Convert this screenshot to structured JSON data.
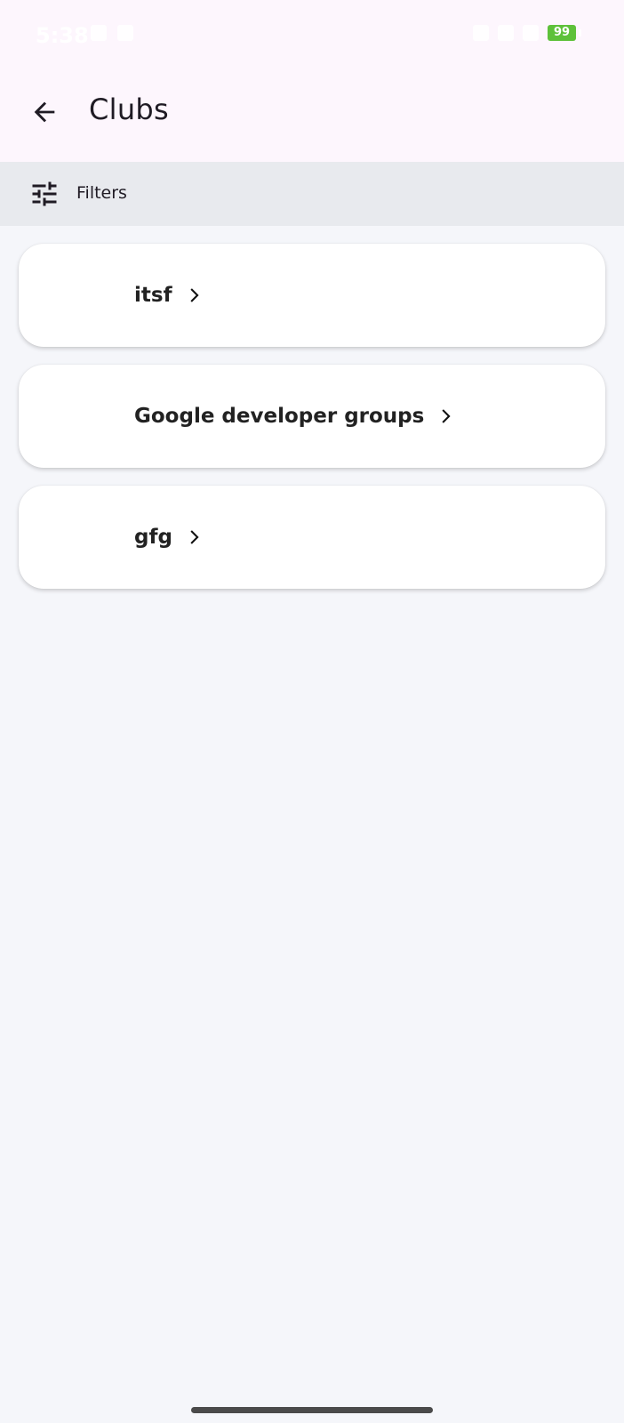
{
  "status_bar": {
    "time": "5:38",
    "battery": "99"
  },
  "app_bar": {
    "title": "Clubs",
    "back_icon": "arrow-back-icon"
  },
  "filter_bar": {
    "icon": "tune-icon",
    "label": "Filters"
  },
  "clubs": [
    {
      "name": "itsf"
    },
    {
      "name": "Google developer groups"
    },
    {
      "name": "gfg"
    }
  ],
  "colors": {
    "app_bar_bg": "#fdf6fd",
    "filter_bg": "#e8eaee",
    "page_bg": "#f5f6fa",
    "card_bg": "#ffffff",
    "battery": "#5ec13a"
  }
}
